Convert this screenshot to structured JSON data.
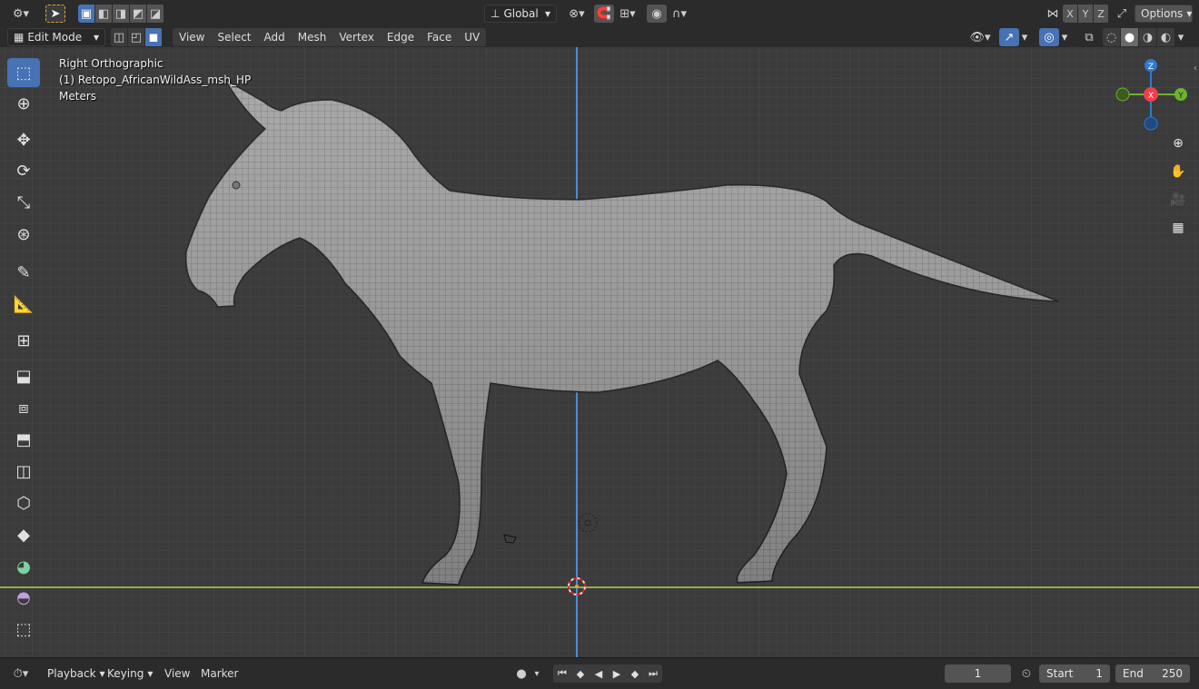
{
  "header": {
    "orientation_label": "Global",
    "options_label": "Options",
    "axes": [
      "X",
      "Y",
      "Z"
    ]
  },
  "modebar": {
    "mode_label": "Edit Mode",
    "menus": [
      "View",
      "Select",
      "Add",
      "Mesh",
      "Vertex",
      "Edge",
      "Face",
      "UV"
    ]
  },
  "viewport": {
    "view_name": "Right Orthographic",
    "object_name": "(1) Retopo_AfricanWildAss_msh_HP",
    "units": "Meters",
    "gizmo": {
      "z": "Z",
      "x": "X",
      "y": "Y"
    }
  },
  "timeline": {
    "menus": [
      "Playback",
      "Keying",
      "View",
      "Marker"
    ],
    "current_frame": "1",
    "start_label": "Start",
    "start_value": "1",
    "end_label": "End",
    "end_value": "250"
  },
  "colors": {
    "accent": "#4772b3",
    "axis_x": "#f23d4d",
    "axis_y": "#6cb42d",
    "axis_z": "#2e7ad1",
    "ground_line": "#8cb04a",
    "vertical_line": "#4c8cd8"
  },
  "icons": [
    "editor-type-icon",
    "select-box-icon",
    "transform-orientation-icon",
    "pivot-icon",
    "snap-icon",
    "proportional-icon",
    "cursor-tool-icon",
    "move-icon",
    "rotate-icon",
    "scale-icon",
    "transform-icon",
    "annotate-icon",
    "measure-icon",
    "add-cube-icon",
    "extrude-icon",
    "inset-icon",
    "bevel-icon",
    "loop-cut-icon",
    "knife-icon",
    "poly-build-icon",
    "spin-icon",
    "smooth-icon",
    "shear-icon",
    "zoom-icon",
    "pan-hand-icon",
    "camera-icon",
    "grid-icon",
    "play-icon",
    "stopwatch-icon"
  ]
}
